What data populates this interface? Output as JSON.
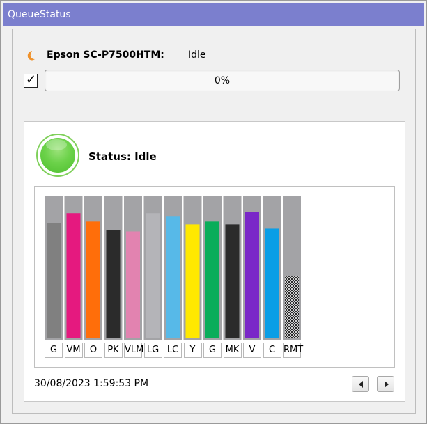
{
  "window": {
    "title": "QueueStatus"
  },
  "printer": {
    "name": "Epson SC-P7500HTM:",
    "state": "Idle",
    "icon": "moon-icon",
    "icon_color": "#f0922b"
  },
  "job": {
    "checkbox_checked": true,
    "progress_percent": 0,
    "progress_label": "0%"
  },
  "status": {
    "label": "Status: Idle",
    "light_color": "#6cd24a"
  },
  "inks": [
    {
      "label": "G",
      "level": 82,
      "color": "#808080"
    },
    {
      "label": "VM",
      "level": 89,
      "color": "#e5197f"
    },
    {
      "label": "O",
      "level": 83,
      "color": "#ff6e0a"
    },
    {
      "label": "PK",
      "level": 77,
      "color": "#2b2b2b"
    },
    {
      "label": "VLM",
      "level": 76,
      "color": "#e283b0"
    },
    {
      "label": "LG",
      "level": 89,
      "color": "#b4b4b8"
    },
    {
      "label": "LC",
      "level": 87,
      "color": "#57b9e8"
    },
    {
      "label": "Y",
      "level": 81,
      "color": "#ffe800"
    },
    {
      "label": "G",
      "level": 83,
      "color": "#0aad5a"
    },
    {
      "label": "MK",
      "level": 81,
      "color": "#2b2b2b"
    },
    {
      "label": "V",
      "level": 90,
      "color": "#7a28c8"
    },
    {
      "label": "C",
      "level": 78,
      "color": "#0a9ee6"
    },
    {
      "label": "RMT",
      "level": 44,
      "color": "pattern"
    }
  ],
  "footer": {
    "timestamp": "30/08/2023 1:59:53 PM"
  }
}
